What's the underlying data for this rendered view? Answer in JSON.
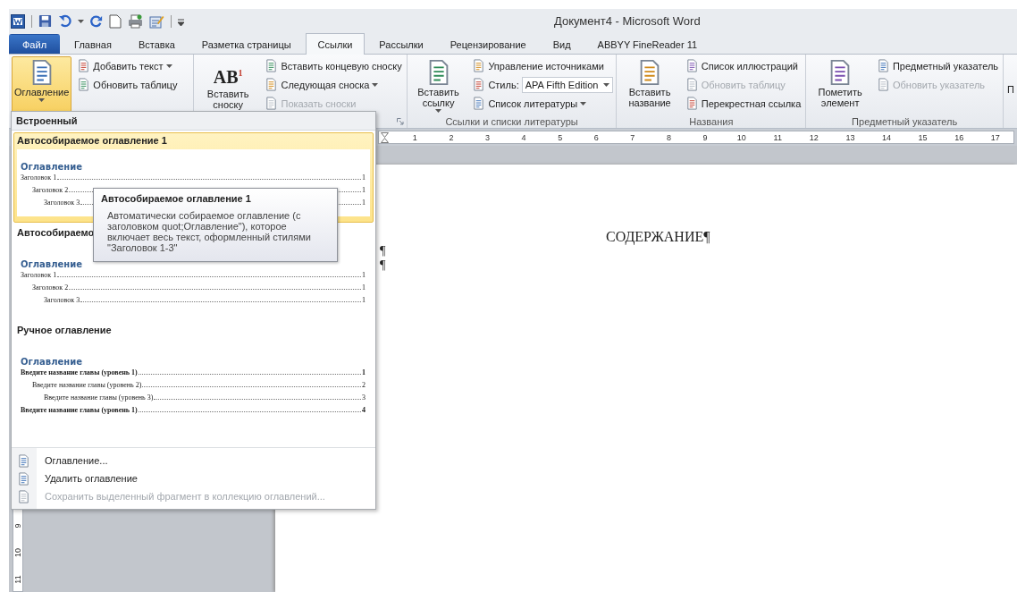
{
  "window": {
    "title": "Документ4  -  Microsoft Word"
  },
  "tabs": [
    {
      "label": "Файл",
      "kind": "file",
      "selected": false
    },
    {
      "label": "Главная",
      "kind": "tab",
      "selected": false
    },
    {
      "label": "Вставка",
      "kind": "tab",
      "selected": false
    },
    {
      "label": "Разметка страницы",
      "kind": "tab",
      "selected": false
    },
    {
      "label": "Ссылки",
      "kind": "tab",
      "selected": true
    },
    {
      "label": "Рассылки",
      "kind": "tab",
      "selected": false
    },
    {
      "label": "Рецензирование",
      "kind": "tab",
      "selected": false
    },
    {
      "label": "Вид",
      "kind": "tab",
      "selected": false
    },
    {
      "label": "ABBYY FineReader 11",
      "kind": "tab",
      "selected": false
    }
  ],
  "ribbon": {
    "groups": [
      {
        "launcher": false,
        "items": [
          {
            "kind": "large",
            "label": "Оглавление",
            "dropdown": true,
            "pressed": true
          },
          {
            "kind": "small",
            "label": "Добавить текст",
            "dropdown": true,
            "disabled": false
          },
          {
            "kind": "small",
            "label": "Обновить таблицу",
            "dropdown": false,
            "disabled": false
          }
        ]
      },
      {
        "launcher": true,
        "items": [
          {
            "kind": "large",
            "label": "Вставить сноску",
            "icon_text": "AB$^{1}$",
            "dropdown": false,
            "pressed": false
          },
          {
            "kind": "small",
            "label": "Вставить концевую сноску",
            "dropdown": false,
            "disabled": false
          },
          {
            "kind": "small",
            "label": "Следующая сноска",
            "dropdown": true,
            "disabled": false
          },
          {
            "kind": "small",
            "label": "Показать сноски",
            "dropdown": false,
            "disabled": true
          }
        ]
      },
      {
        "label": "Ссылки и списки литературы",
        "launcher": false,
        "items": [
          {
            "kind": "large",
            "label": "Вставить ссылку",
            "dropdown": true,
            "pressed": false
          },
          {
            "kind": "small",
            "label": "Управление источниками",
            "dropdown": false,
            "disabled": false
          },
          {
            "kind": "style",
            "label": "Стиль:",
            "value": "APA Fifth Edition"
          },
          {
            "kind": "small",
            "label": "Список литературы",
            "dropdown": true,
            "disabled": false
          }
        ]
      },
      {
        "label": "Названия",
        "launcher": false,
        "items": [
          {
            "kind": "large",
            "label": "Вставить название",
            "dropdown": false,
            "pressed": false
          },
          {
            "kind": "small",
            "label": "Список иллюстраций",
            "dropdown": false,
            "disabled": false
          },
          {
            "kind": "small",
            "label": "Обновить таблицу",
            "dropdown": false,
            "disabled": true
          },
          {
            "kind": "small",
            "label": "Перекрестная ссылка",
            "dropdown": false,
            "disabled": false
          }
        ]
      },
      {
        "label": "Предметный указатель",
        "launcher": false,
        "items": [
          {
            "kind": "large",
            "label": "Пометить элемент",
            "dropdown": false,
            "pressed": false
          },
          {
            "kind": "small",
            "label": "Предметный указатель",
            "dropdown": false,
            "disabled": false
          },
          {
            "kind": "small",
            "label": "Обновить указатель",
            "dropdown": false,
            "disabled": true
          }
        ]
      },
      {
        "launcher": false,
        "items": [
          {
            "kind": "cut",
            "label": "П"
          }
        ]
      }
    ]
  },
  "horizontal_ruler": {
    "numbers": [
      "1",
      "2",
      "3",
      "4",
      "5",
      "6",
      "7",
      "8",
      "9",
      "10",
      "11",
      "12",
      "13",
      "14",
      "15",
      "16",
      "17"
    ]
  },
  "vertical_ruler": {
    "numbers": [
      "9",
      "10",
      "11"
    ]
  },
  "document": {
    "heading": "СОДЕРЖАНИЕ¶",
    "marks": [
      "¶",
      "¶"
    ]
  },
  "menu": {
    "header": "Встроенный",
    "gallery": [
      {
        "title": "Автособираемое оглавление 1",
        "kind": "auto",
        "selected": true,
        "preview": {
          "heading": "Оглавление",
          "entries": [
            {
              "text": "Заголовок 1",
              "page": "1",
              "children": [
                {
                  "text": "Заголовок 2",
                  "page": "1",
                  "children": [
                    {
                      "text": "Заголовок 3",
                      "page": "1"
                    }
                  ]
                }
              ]
            }
          ]
        }
      },
      {
        "title": "Автособираемо",
        "kind": "auto",
        "selected": false,
        "preview": {
          "heading": "Оглавление",
          "entries": [
            {
              "text": "Заголовок 1",
              "page": "1",
              "children": [
                {
                  "text": "Заголовок 2",
                  "page": "1",
                  "children": [
                    {
                      "text": "Заголовок 3",
                      "page": "1"
                    }
                  ]
                }
              ]
            }
          ]
        }
      },
      {
        "title": "Ручное оглавление",
        "kind": "manual",
        "selected": false,
        "preview": {
          "heading": "Оглавление",
          "entries": [
            {
              "text": "Введите название главы (уровень 1)",
              "page": "1",
              "children": [
                {
                  "text": "Введите название главы (уровень 2)",
                  "page": "2",
                  "children": [
                    {
                      "text": "Введите название главы (уровень 3)",
                      "page": "3"
                    }
                  ]
                }
              ]
            },
            {
              "text": "Введите название главы (уровень 1)",
              "page": "4"
            }
          ]
        }
      }
    ],
    "commands": [
      {
        "label": "Оглавление...",
        "disabled": false
      },
      {
        "label": "Удалить оглавление",
        "disabled": false
      },
      {
        "label": "Сохранить выделенный фрагмент в коллекцию оглавлений...",
        "disabled": true
      }
    ]
  },
  "tooltip": {
    "title": "Автособираемое оглавление 1",
    "text": "Автоматически собираемое оглавление (с заголовком quot;Оглавление\"), которое включает весь текст, оформленный стилями \"Заголовок 1-3\""
  }
}
